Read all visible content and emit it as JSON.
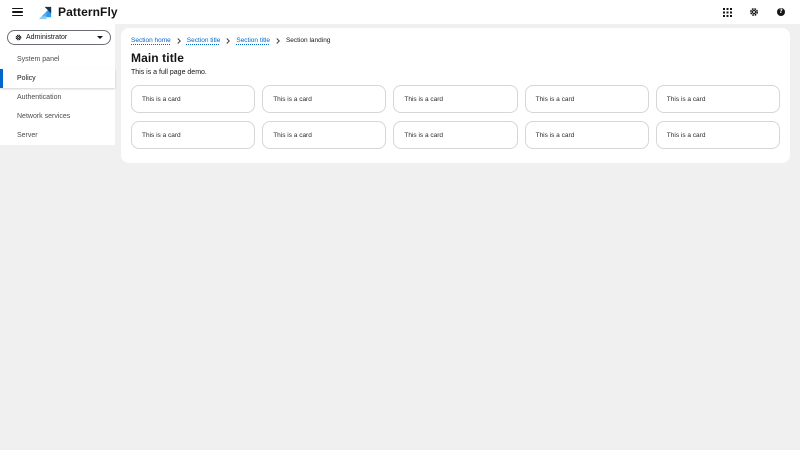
{
  "header": {
    "brand": "PatternFly",
    "icons": [
      "menu-icon",
      "app-launcher-grid-icon",
      "settings-gear-icon",
      "help-question-icon"
    ]
  },
  "sidebar": {
    "context_selector": {
      "label": "Administrator",
      "icon": "gear-icon",
      "caret": "caret-down-icon"
    },
    "items": [
      {
        "label": "System panel",
        "selected": false
      },
      {
        "label": "Policy",
        "selected": true
      },
      {
        "label": "Authentication",
        "selected": false
      },
      {
        "label": "Network services",
        "selected": false
      },
      {
        "label": "Server",
        "selected": false
      }
    ]
  },
  "main": {
    "breadcrumb": {
      "items": [
        {
          "label": "Section home",
          "type": "link"
        },
        {
          "label": "Section title",
          "type": "link"
        },
        {
          "label": "Section title",
          "type": "link"
        },
        {
          "label": "Section landing",
          "type": "current"
        }
      ]
    },
    "title": "Main title",
    "subtitle": "This is a full page demo.",
    "cards": [
      "This is a card",
      "This is a card",
      "This is a card",
      "This is a card",
      "This is a card",
      "This is a card",
      "This is a card",
      "This is a card",
      "This is a card",
      "This is a card"
    ]
  },
  "colors": {
    "accent_blue": "#0066cc",
    "page_background": "#f0f0f0",
    "surface": "#ffffff",
    "text_primary": "#151515",
    "text_nav": "#4d4d4d",
    "card_border": "#d6d6d6",
    "logo_navy": "#1b3650",
    "logo_blue": "#2b9af3",
    "logo_light_blue": "#8ccbf2"
  }
}
